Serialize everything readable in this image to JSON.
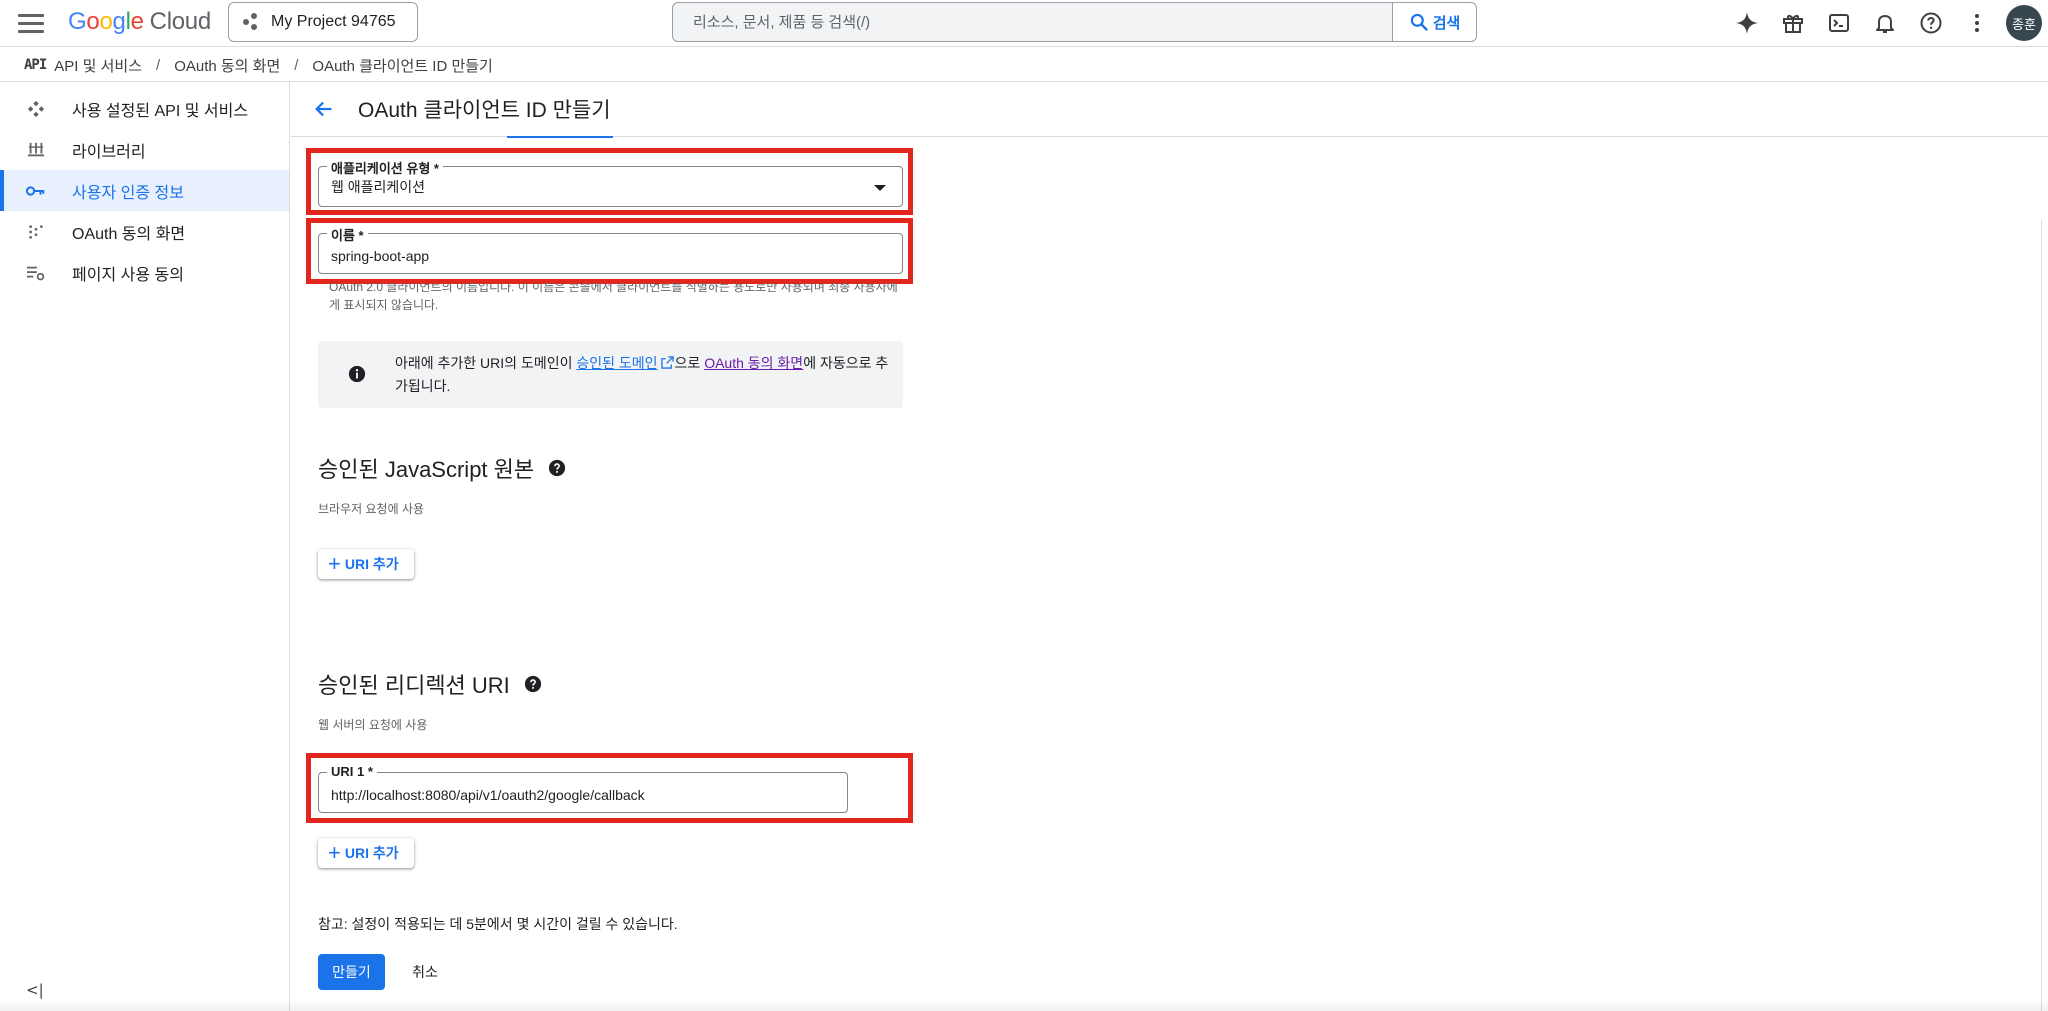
{
  "topbar": {
    "logo_letters": [
      "G",
      "o",
      "o",
      "g",
      "l",
      "e"
    ],
    "logo_product": "Cloud",
    "project_name": "My Project 94765",
    "search_placeholder": "리소스, 문서, 제품 등 검색(/)",
    "search_button": "검색",
    "avatar_text": "종훈",
    "icons": [
      "gemini-sparkle-icon",
      "gift-icon",
      "cloud-shell-icon",
      "notifications-bell-icon",
      "help-icon",
      "more-vert-icon"
    ]
  },
  "breadcrumb": {
    "api_logo": "API",
    "items": [
      "API 및 서비스",
      "OAuth 동의 화면",
      "OAuth 클라이언트 ID 만들기"
    ]
  },
  "sidebar": {
    "items": [
      {
        "label": "사용 설정된 API 및 서비스",
        "icon": "apis-icon"
      },
      {
        "label": "라이브러리",
        "icon": "library-icon"
      },
      {
        "label": "사용자 인증 정보",
        "icon": "key-icon",
        "active": true
      },
      {
        "label": "OAuth 동의 화면",
        "icon": "consent-icon"
      },
      {
        "label": "페이지 사용 동의",
        "icon": "page-settings-icon"
      }
    ],
    "collapse_icon": "<|"
  },
  "main": {
    "title": "OAuth 클라이언트 ID 만들기",
    "app_type": {
      "label": "애플리케이션 유형 *",
      "value": "웹 애플리케이션"
    },
    "name": {
      "label": "이름 *",
      "value": "spring-boot-app"
    },
    "name_hint": "OAuth 2.0 클라이언트의 이름입니다. 이 이름은 콘솔에서 클라이언트를 식별하는 용도로만 사용되며 최종 사용자에게 표시되지 않습니다.",
    "info": {
      "prefix": "아래에 추가한 URI의 도메인이 ",
      "link1": "승인된 도메인",
      "mid": "으로 ",
      "link2": "OAuth 동의 화면",
      "suffix": "에 자동으로 추가됩니다."
    },
    "js_origins": {
      "title": "승인된 JavaScript 원본",
      "subtitle": "브라우저 요청에 사용",
      "add_label": "URI 추가"
    },
    "redirect_uris": {
      "title": "승인된 리디렉션 URI",
      "subtitle": "웹 서버의 요청에 사용",
      "uri1": {
        "label": "URI 1 *",
        "value": "http://localhost:8080/api/v1/oauth2/google/callback"
      },
      "add_label": "URI 추가"
    },
    "note": "참고: 설정이 적용되는 데 5분에서 몇 시간이 걸릴 수 있습니다.",
    "create_label": "만들기",
    "cancel_label": "취소"
  },
  "colors": {
    "accent": "#1a73e8",
    "highlight_box": "#e3271c",
    "active_nav_bg": "#e8f0fe",
    "visited_link": "#681da8"
  }
}
